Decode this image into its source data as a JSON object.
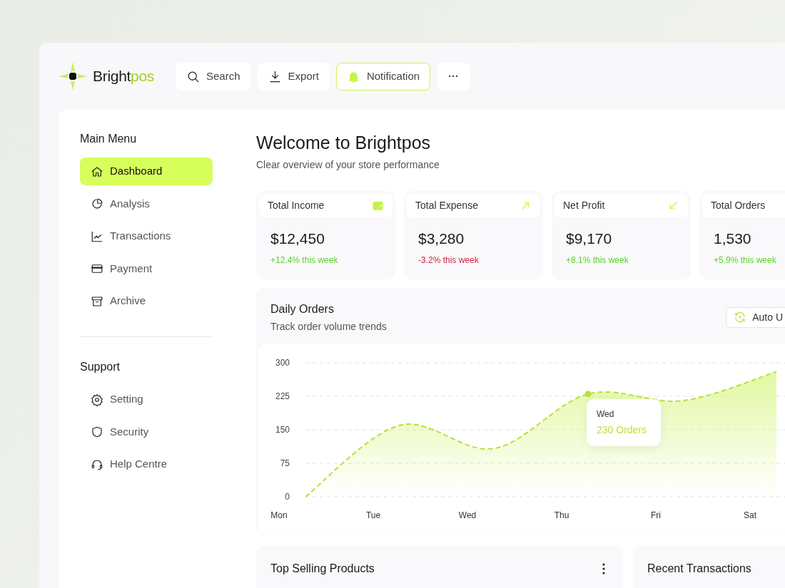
{
  "brand": {
    "name": "Bright",
    "accent": "pos"
  },
  "header_buttons": [
    {
      "kind": "search",
      "label": "Search",
      "selected": false
    },
    {
      "kind": "export",
      "label": "Export",
      "selected": false
    },
    {
      "kind": "bell",
      "label": "Notification",
      "selected": true
    },
    {
      "kind": "more",
      "label": "···",
      "selected": false
    }
  ],
  "sidebar": {
    "sections": [
      {
        "title": "Main Menu",
        "items": [
          {
            "label": "Dashboard",
            "selected": true
          },
          {
            "label": "Analysis",
            "selected": false
          },
          {
            "label": "Transactions",
            "selected": false
          },
          {
            "label": "Payment",
            "selected": false
          },
          {
            "label": "Archive",
            "selected": false
          }
        ]
      },
      {
        "title": "Support",
        "items": [
          {
            "label": "Setting",
            "selected": false
          },
          {
            "label": "Security",
            "selected": false
          },
          {
            "label": "Help Centre",
            "selected": false
          }
        ]
      }
    ]
  },
  "welcome": {
    "title": "Welcome to Brightpos",
    "subtitle": "Clear overview of your store performance"
  },
  "stats": [
    {
      "label": "Total Income",
      "value": "$12,450",
      "change": "+12.4% this week",
      "color": "#5bd12c"
    },
    {
      "label": "Total Expense",
      "value": "$3,280",
      "change": "-3.2% this week",
      "color": "#d0243c"
    },
    {
      "label": "Net Profit",
      "value": "$9,170",
      "change": "+8.1% this week",
      "color": "#5bd12c"
    },
    {
      "label": "Total Orders",
      "value": "1,530",
      "change": "+5.9% this week",
      "color": "#5bd12c"
    }
  ],
  "daily_orders": {
    "title": "Daily Orders",
    "subtitle": "Track order volume trends",
    "button": "Auto U",
    "tooltip": {
      "day": "Wed",
      "text": "230 Orders"
    },
    "chart_data": {
      "type": "area",
      "categories": [
        "Mon",
        "Tue",
        "Wed",
        "Thu",
        "Fri",
        "Sat"
      ],
      "series": [
        {
          "color": "#b9e03a",
          "values": [
            0,
            160,
            108,
            230,
            215,
            280
          ]
        }
      ],
      "ylim": [
        0,
        300
      ],
      "yticks": [
        300,
        225,
        150,
        75,
        0
      ],
      "grid": true
    }
  },
  "bottom_cards": [
    {
      "title": "Top Selling Products",
      "menu": true
    },
    {
      "title": "Recent Transactions",
      "menu": false
    }
  ]
}
